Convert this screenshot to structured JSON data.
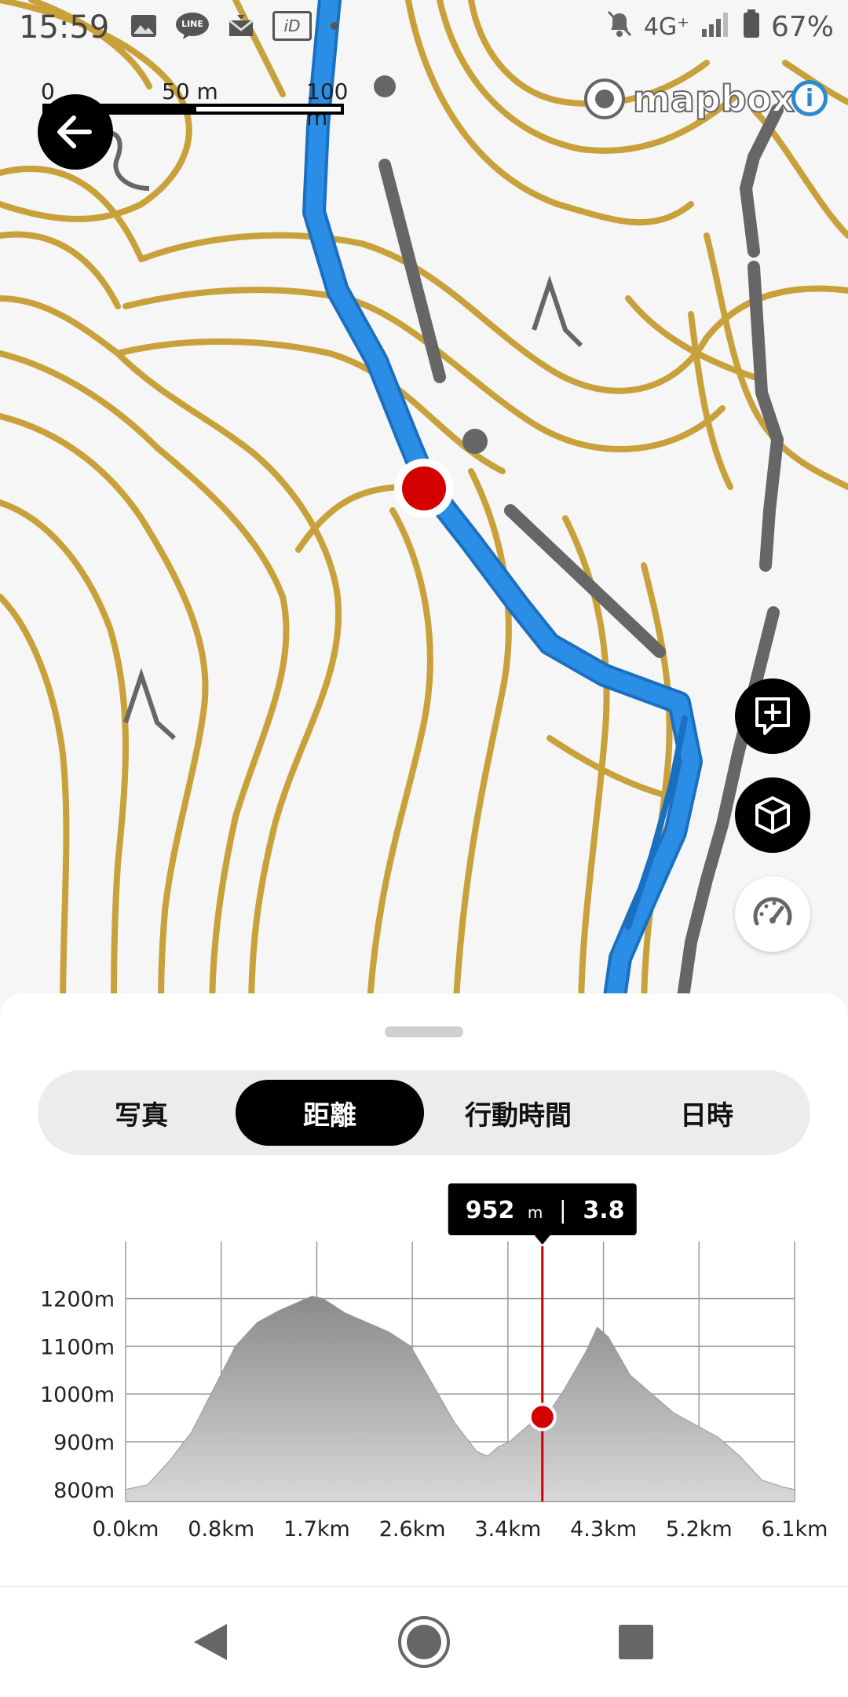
{
  "status_bar": {
    "time": "15:59",
    "network": "4G⁺",
    "battery": "67%",
    "left_icons": [
      "image-icon",
      "line-app-icon",
      "mail-icon",
      "id-icon",
      "dot-icon"
    ],
    "line_badge": "LINE",
    "id_badge": "iD"
  },
  "map": {
    "scale": {
      "label_0": "0",
      "label_50": "50 m",
      "label_100": "100 m"
    },
    "attribution": "mapbox",
    "info_label": "i",
    "colors": {
      "contour": "#c9a13b",
      "route": "#2b8ee6",
      "trail": "#666666",
      "marker": "#d40000"
    }
  },
  "sheet": {
    "tabs": [
      {
        "label": "写真",
        "active": false
      },
      {
        "label": "距離",
        "active": true
      },
      {
        "label": "行動時間",
        "active": false
      },
      {
        "label": "日時",
        "active": false
      }
    ]
  },
  "chart_data": {
    "type": "area",
    "x_unit": "km",
    "x_tick_labels": [
      "0.0km",
      "0.8km",
      "1.7km",
      "2.6km",
      "3.4km",
      "4.3km",
      "5.2km",
      "6.1km"
    ],
    "y_tick_labels": [
      "1200m",
      "1100m",
      "1000m",
      "900m",
      "800m"
    ],
    "ylim": [
      775,
      1270
    ],
    "xlim": [
      0,
      6.1
    ],
    "grid": true,
    "x": [
      0.0,
      0.2,
      0.4,
      0.6,
      0.8,
      1.0,
      1.2,
      1.4,
      1.6,
      1.7,
      1.8,
      2.0,
      2.2,
      2.4,
      2.6,
      2.8,
      3.0,
      3.2,
      3.3,
      3.4,
      3.5,
      3.6,
      3.7,
      3.8,
      3.9,
      4.0,
      4.1,
      4.2,
      4.3,
      4.4,
      4.5,
      4.6,
      4.8,
      5.0,
      5.2,
      5.4,
      5.6,
      5.8,
      6.0,
      6.1
    ],
    "y": [
      800,
      810,
      860,
      920,
      1010,
      1100,
      1150,
      1175,
      1195,
      1205,
      1200,
      1170,
      1150,
      1130,
      1100,
      1020,
      940,
      880,
      870,
      890,
      900,
      920,
      940,
      952,
      975,
      1010,
      1050,
      1090,
      1140,
      1120,
      1080,
      1040,
      1000,
      960,
      935,
      910,
      870,
      820,
      805,
      800
    ],
    "cursor": {
      "elevation": "952",
      "elevation_unit": "m",
      "distance": "3.8",
      "distance_unit": "km",
      "x": 3.8,
      "y": 952
    },
    "colors": {
      "fill_top": "#8a8a8a",
      "fill_bottom": "#d8d8d8",
      "cursor": "#cc0000"
    }
  },
  "nav_bar": {
    "buttons": [
      "back",
      "home",
      "recents"
    ]
  }
}
